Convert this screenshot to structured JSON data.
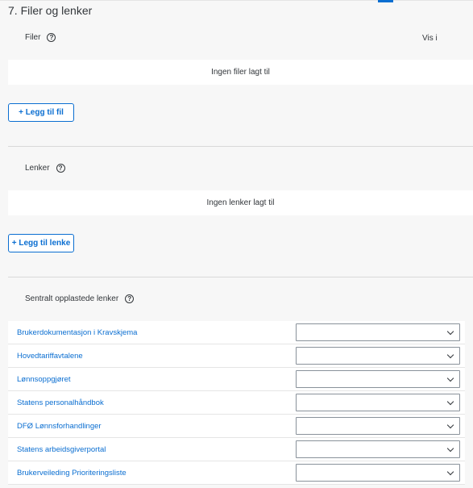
{
  "section": {
    "title": "7. Filer og lenker"
  },
  "files": {
    "label": "Filer",
    "show_in_label": "Vis i",
    "empty_text": "Ingen filer lagt til",
    "add_button": "+ Legg til fil"
  },
  "links": {
    "label": "Lenker",
    "empty_text": "Ingen lenker lagt til",
    "add_button": "+ Legg til lenke"
  },
  "central_links": {
    "label": "Sentralt opplastede lenker",
    "items": [
      {
        "label": "Brukerdokumentasjon i Kravskjema",
        "select_value": ""
      },
      {
        "label": "Hovedtariffavtalene",
        "select_value": ""
      },
      {
        "label": "Lønnsoppgjøret",
        "select_value": ""
      },
      {
        "label": "Statens personalhåndbok",
        "select_value": ""
      },
      {
        "label": "DFØ Lønnsforhandlinger",
        "select_value": ""
      },
      {
        "label": "Statens arbeidsgiverportal",
        "select_value": ""
      },
      {
        "label": "Brukerveileding Prioriteringsliste",
        "select_value": ""
      }
    ]
  },
  "icons": {
    "help": "help-circle-icon",
    "dropdown": "chevron-down-icon"
  },
  "colors": {
    "accent": "#0a6ed1",
    "background": "#f7f7f7",
    "text": "#32363a"
  }
}
